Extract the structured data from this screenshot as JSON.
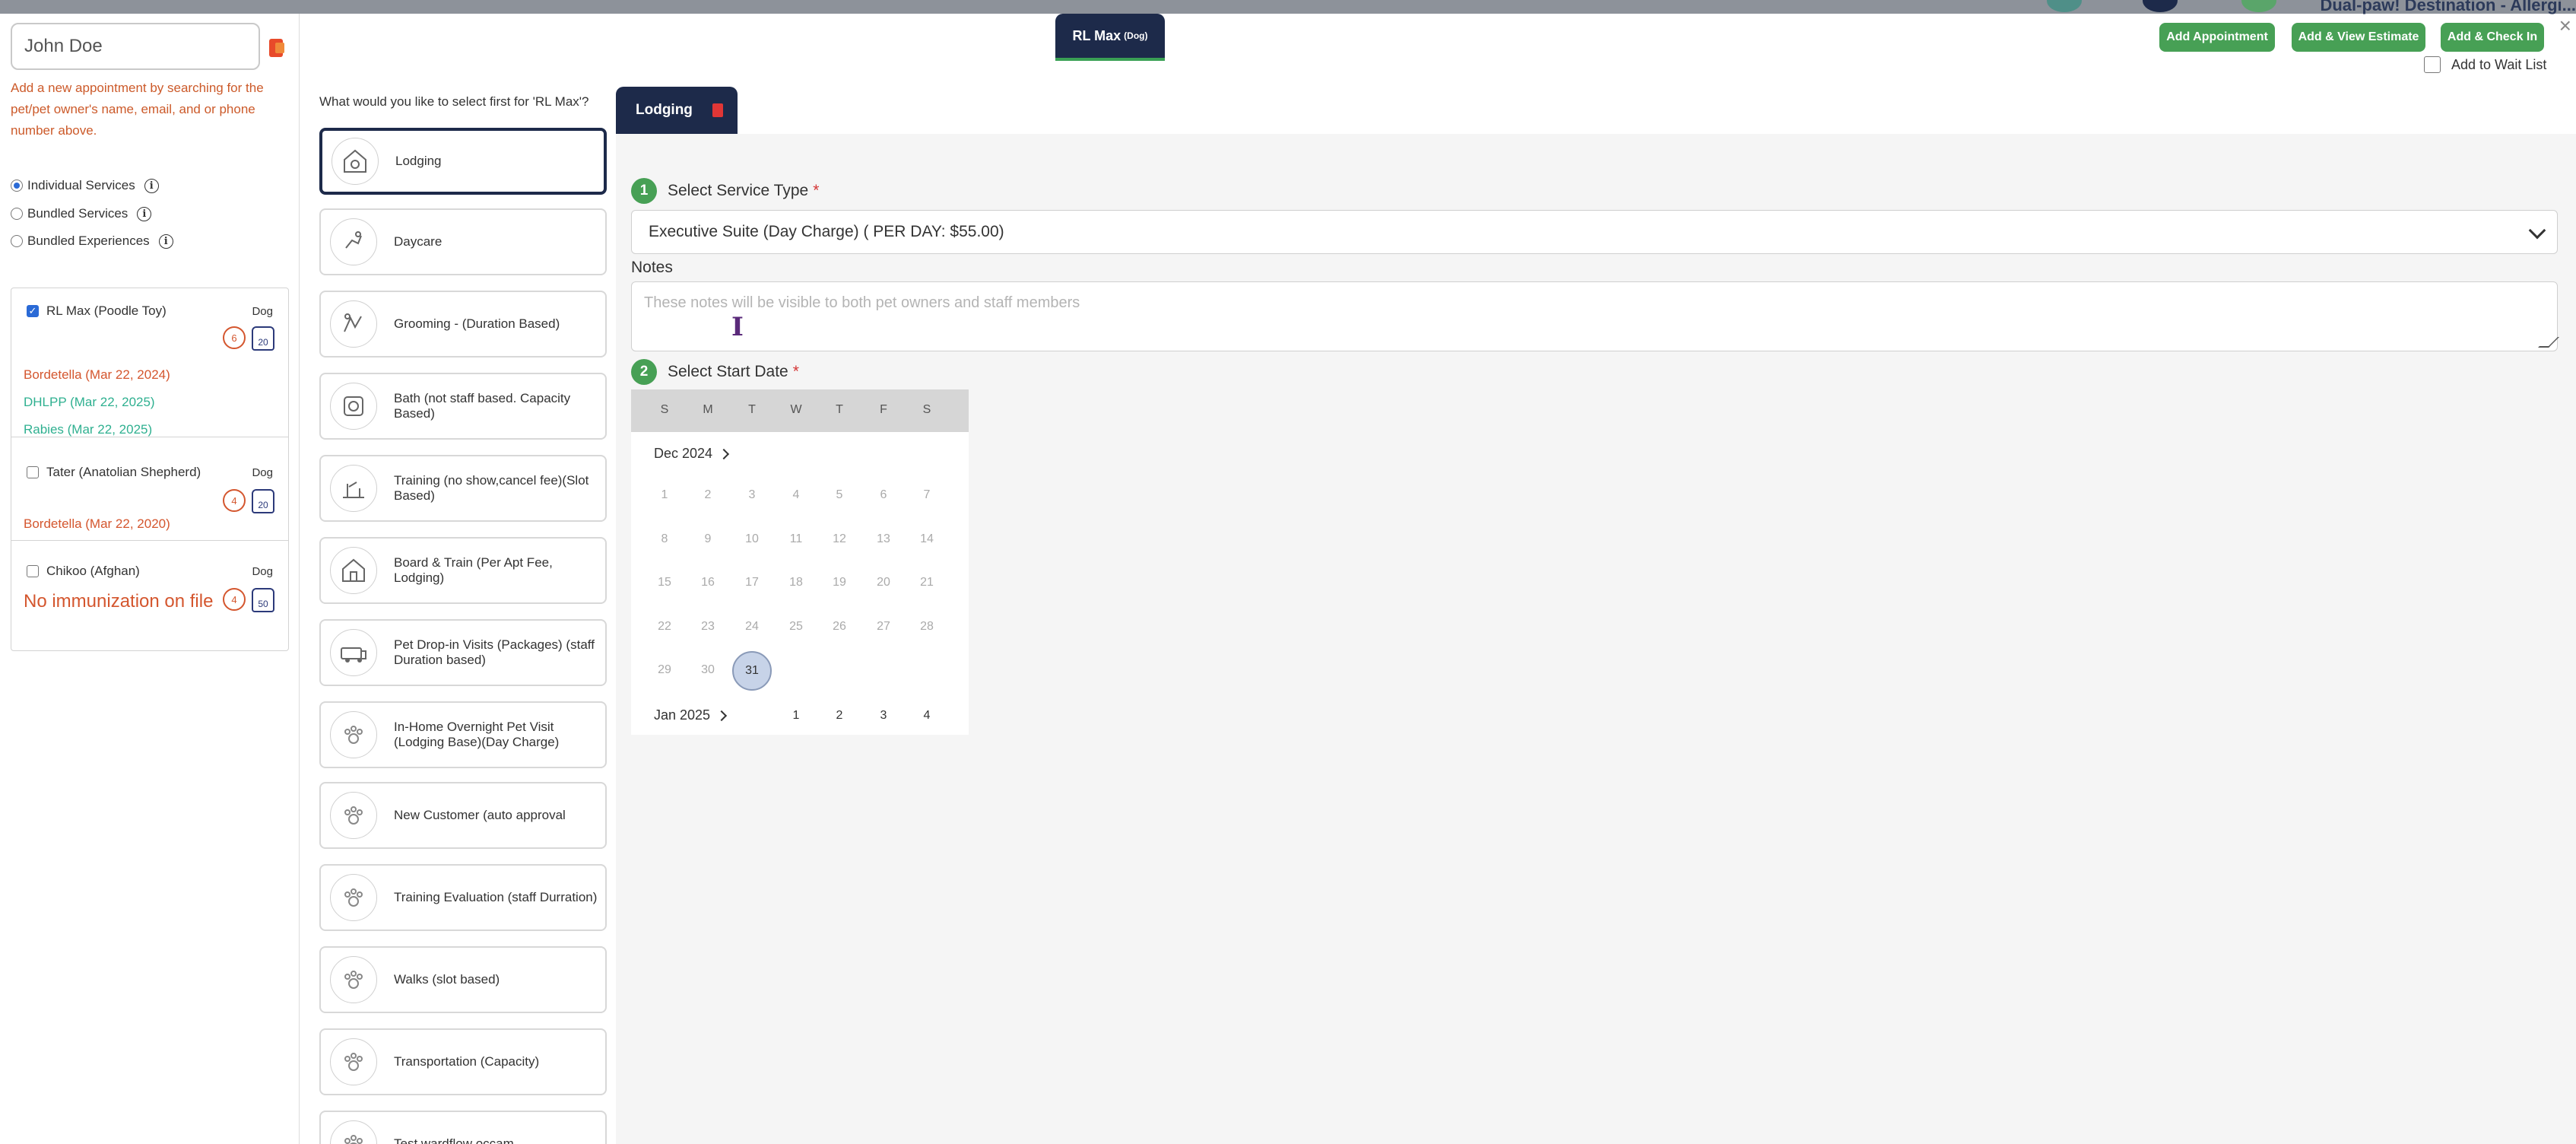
{
  "background_bar": {
    "text": "Dual-paw! Destination - Allergi..."
  },
  "left": {
    "search_value": "John Doe",
    "help_text": "Add a new appointment by searching for the pet/pet owner's name, email, and or phone number above.",
    "service_modes": [
      {
        "label": "Individual Services",
        "selected": true
      },
      {
        "label": "Bundled Services",
        "selected": false
      },
      {
        "label": "Bundled Experiences",
        "selected": false
      }
    ],
    "pets": [
      {
        "name": "RL Max (Poodle Toy)",
        "species": "Dog",
        "checked": true,
        "circle_badge": "6",
        "bag_badge": "20",
        "vaccines": [
          {
            "text": "Bordetella (Mar 22, 2024)",
            "status": "red"
          },
          {
            "text": "DHLPP (Mar 22, 2025)",
            "status": "green"
          },
          {
            "text": "Rabies (Mar 22, 2025)",
            "status": "green"
          }
        ]
      },
      {
        "name": "Tater (Anatolian Shepherd)",
        "species": "Dog",
        "checked": false,
        "circle_badge": "4",
        "bag_badge": "20",
        "vaccines": [
          {
            "text": "Bordetella (Mar 22, 2020)",
            "status": "red"
          }
        ]
      },
      {
        "name": "Chikoo (Afghan)",
        "species": "Dog",
        "checked": false,
        "circle_badge": "4",
        "bag_badge": "50",
        "vaccines": [
          {
            "text": "No immunization on file",
            "status": "red"
          }
        ]
      }
    ]
  },
  "middle": {
    "prompt": "What would you like to select first for 'RL Max'?",
    "services": [
      {
        "label": "Lodging",
        "icon": "house-dog-icon",
        "selected": true
      },
      {
        "label": "Daycare",
        "icon": "dog-run-icon",
        "selected": false
      },
      {
        "label": "Grooming - (Duration Based)",
        "icon": "grooming-icon",
        "selected": false
      },
      {
        "label": "Bath (not staff based. Capacity Based)",
        "icon": "bath-icon",
        "selected": false
      },
      {
        "label": "Training (no show,cancel fee)(Slot Based)",
        "icon": "training-icon",
        "selected": false
      },
      {
        "label": "Board & Train (Per Apt Fee, Lodging)",
        "icon": "board-train-icon",
        "selected": false
      },
      {
        "label": "Pet Drop-in Visits (Packages) (staff Duration based)",
        "icon": "van-icon",
        "selected": false
      },
      {
        "label": "In-Home Overnight Pet Visit (Lodging Base)(Day Charge)",
        "icon": "paw-icon",
        "selected": false
      },
      {
        "label": "New Customer (auto approval",
        "icon": "paw-icon",
        "selected": false
      },
      {
        "label": "Training Evaluation (staff Durration)",
        "icon": "paw-icon",
        "selected": false
      },
      {
        "label": "Walks (slot based)",
        "icon": "paw-icon",
        "selected": false
      },
      {
        "label": "Transportation (Capacity)",
        "icon": "paw-icon",
        "selected": false
      },
      {
        "label": "Test wardflow occam",
        "icon": "paw-icon",
        "selected": false
      }
    ]
  },
  "header": {
    "pet_tab": "RL Max",
    "pet_tab_species": "(Dog)",
    "buttons": {
      "add_appointment": "Add Appointment",
      "add_view_estimate": "Add & View Estimate",
      "add_check_in": "Add & Check In"
    },
    "close": "×",
    "wait_list": "Add to Wait List"
  },
  "form": {
    "tab_label": "Lodging",
    "step1_num": "1",
    "step1_label": "Select Service Type",
    "required_mark": "*",
    "service_type_value": "Executive Suite (Day Charge) ( PER DAY: $55.00)",
    "notes_label": "Notes",
    "notes_placeholder": "These notes will be visible to both pet owners and staff members",
    "step2_num": "2",
    "step2_label": "Select Start Date"
  },
  "calendar": {
    "weekdays": [
      "S",
      "M",
      "T",
      "W",
      "T",
      "F",
      "S"
    ],
    "month1": "Dec 2024",
    "weeks": [
      [
        "1",
        "2",
        "3",
        "4",
        "5",
        "6",
        "7"
      ],
      [
        "8",
        "9",
        "10",
        "11",
        "12",
        "13",
        "14"
      ],
      [
        "15",
        "16",
        "17",
        "18",
        "19",
        "20",
        "21"
      ],
      [
        "22",
        "23",
        "24",
        "25",
        "26",
        "27",
        "28"
      ],
      [
        "29",
        "30",
        "31",
        "",
        "",
        "",
        ""
      ]
    ],
    "selected_day": "31",
    "month2": "Jan 2025",
    "month2_days": [
      "1",
      "2",
      "3",
      "4"
    ]
  }
}
